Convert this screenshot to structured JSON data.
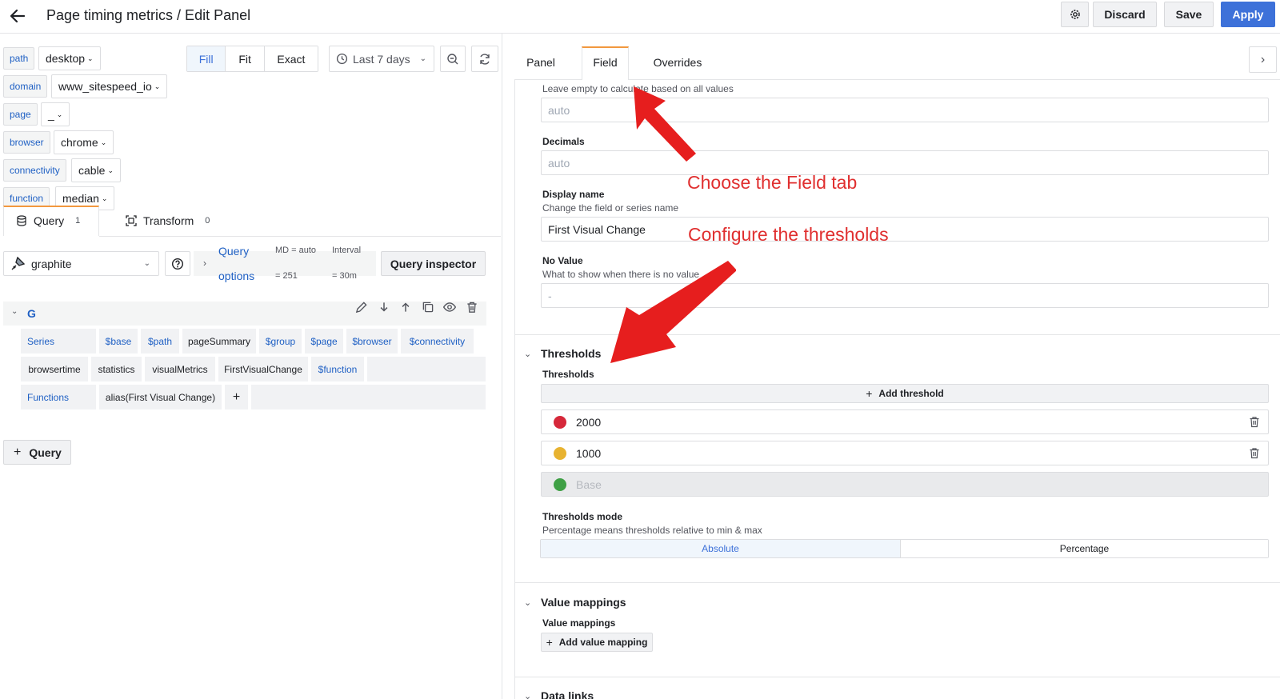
{
  "header": {
    "title": "Page timing metrics / Edit Panel",
    "discard_label": "Discard",
    "save_label": "Save",
    "apply_label": "Apply"
  },
  "variables": [
    {
      "label": "path",
      "value": "desktop"
    },
    {
      "label": "domain",
      "value": "www_sitespeed_io"
    },
    {
      "label": "page",
      "value": "_"
    },
    {
      "label": "browser",
      "value": "chrome"
    },
    {
      "label": "connectivity",
      "value": "cable"
    },
    {
      "label": "function",
      "value": "median"
    }
  ],
  "display_modes": {
    "fill": "Fill",
    "fit": "Fit",
    "exact": "Exact",
    "selected": "Fill"
  },
  "time_range": "Last 7 days",
  "query_tabs": {
    "query_label": "Query",
    "query_count": "1",
    "transform_label": "Transform",
    "transform_count": "0"
  },
  "datasource": {
    "name": "graphite",
    "options_label_1": "Query",
    "options_label_2": "options",
    "md_label": "MD = auto",
    "md_value": "= 251",
    "interval_label": "Interval",
    "interval_value": "= 30m",
    "inspector_label": "Query inspector"
  },
  "query_row": {
    "ref_id": "G",
    "series_label": "Series",
    "series_segments": [
      "$base",
      "$path",
      "pageSummary",
      "$group",
      "$page",
      "$browser",
      "$connectivity"
    ],
    "series_segments_row2": [
      "browsertime",
      "statistics",
      "visualMetrics",
      "FirstVisualChange",
      "$function"
    ],
    "functions_label": "Functions",
    "function_value": "alias(First Visual Change)",
    "add_symbol": "+"
  },
  "add_query_label": "Query",
  "right_tabs": {
    "panel": "Panel",
    "field": "Field",
    "overrides": "Overrides",
    "active": "Field"
  },
  "field_options": {
    "min_max_desc": "Leave empty to calculate based on all values",
    "min_max_placeholder": "auto",
    "decimals_label": "Decimals",
    "decimals_placeholder": "auto",
    "display_name_label": "Display name",
    "display_name_desc": "Change the field or series name",
    "display_name_value": "First Visual Change",
    "no_value_label": "No Value",
    "no_value_desc": "What to show when there is no value",
    "no_value_placeholder": "-"
  },
  "thresholds": {
    "section_title": "Thresholds",
    "label": "Thresholds",
    "add_label": "Add threshold",
    "items": [
      {
        "value": "2000",
        "color": "#d6283a"
      },
      {
        "value": "1000",
        "color": "#e8b331"
      },
      {
        "value": "Base",
        "color": "#3fa045"
      }
    ],
    "mode_label": "Thresholds mode",
    "mode_desc": "Percentage means thresholds relative to min & max",
    "mode_absolute": "Absolute",
    "mode_percentage": "Percentage",
    "mode_selected": "Absolute"
  },
  "value_mappings": {
    "section_title": "Value mappings",
    "label": "Value mappings",
    "add_label": "Add value mapping"
  },
  "data_links": {
    "section_title": "Data links"
  },
  "annotations": {
    "field_tab": "Choose the Field tab",
    "thresholds": "Configure the thresholds"
  },
  "colors": {
    "accent": "#3d71d9",
    "link": "#1f60c4",
    "annotation": "#e02f2f"
  }
}
